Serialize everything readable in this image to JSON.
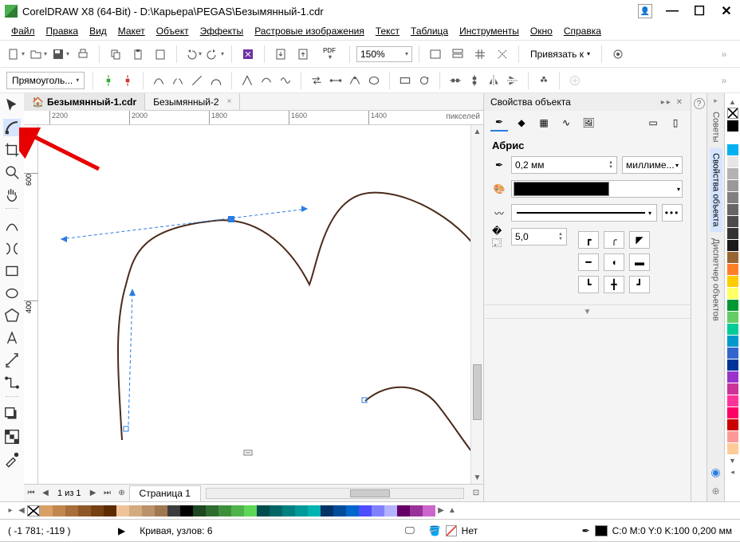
{
  "title": "CorelDRAW X8 (64-Bit) - D:\\Карьера\\PEGAS\\Безымянный-1.cdr",
  "menu": [
    "Файл",
    "Правка",
    "Вид",
    "Макет",
    "Объект",
    "Эффекты",
    "Растровые изображения",
    "Текст",
    "Таблица",
    "Инструменты",
    "Окно",
    "Справка"
  ],
  "toolbar": {
    "zoom": "150%",
    "snap_label": "Привязать к"
  },
  "propbar": {
    "shape_combo": "Прямоуголь..."
  },
  "docs": {
    "tab1": "Безымянный-1.cdr",
    "tab2": "Безымянный-2"
  },
  "ruler": {
    "units": "пикселей",
    "top": [
      "2200",
      "2000",
      "1800",
      "1600",
      "1400"
    ],
    "left": [
      "600",
      "400"
    ]
  },
  "pagebar": {
    "info": "1  из  1",
    "tab": "Страница 1"
  },
  "docker": {
    "title": "Свойства объекта",
    "section": "Абрис",
    "outline_width": "0,2 мм",
    "units": "миллиме...",
    "miter": "5,0"
  },
  "side_tabs": [
    "Советы",
    "Свойства объекта",
    "Диспетчер объектов"
  ],
  "status": {
    "coords": "( -1 781; -119  )",
    "selection": "Кривая, узлов: 6",
    "fill_none": "Нет",
    "outline_info": "C:0 M:0 Y:0 K:100  0,200 мм"
  },
  "side_palette": [
    "#000000",
    "#ffffff",
    "#00b0f0",
    "#e6e6e6",
    "#b3b3b3",
    "#999999",
    "#808080",
    "#666666",
    "#4d4d4d",
    "#333333",
    "#1a1a1a",
    "#996633",
    "#ff7f27",
    "#ffcc00",
    "#ffff66",
    "#009933",
    "#66cc66",
    "#00cc99",
    "#0099cc",
    "#3366cc",
    "#003399",
    "#9933cc",
    "#cc3399",
    "#ff3399",
    "#ff0066",
    "#cc0000",
    "#ff9999",
    "#ffcc99"
  ],
  "bottom_palette": [
    "#d9a066",
    "#c1874f",
    "#a86f3a",
    "#8f5726",
    "#764012",
    "#5e2a00",
    "#eec39a",
    "#d4aa81",
    "#ba9168",
    "#a0784f",
    "#3c3c3c",
    "#000000",
    "#1e4620",
    "#2e6b2e",
    "#3e8f3c",
    "#4eb34a",
    "#5ed758",
    "#004d4d",
    "#006666",
    "#008080",
    "#009999",
    "#00b3b3",
    "#003366",
    "#004c99",
    "#0066cc",
    "#4d4dff",
    "#8080ff",
    "#b3b3ff",
    "#660066",
    "#993399",
    "#cc66cc"
  ]
}
